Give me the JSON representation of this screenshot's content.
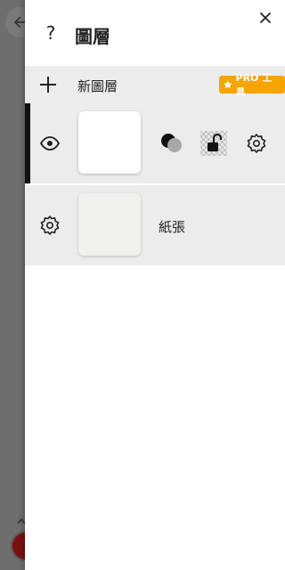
{
  "header": {
    "help_symbol": "?",
    "title": "圖層"
  },
  "new_layer": {
    "label": "新圖層",
    "pro_badge": "PRO 工具",
    "badge_color": "#f5a400"
  },
  "layers": [
    {
      "icons": [
        "eye-icon",
        "blend-mode-icon",
        "lock-icon",
        "gear-icon"
      ],
      "active": true
    }
  ],
  "paper": {
    "label": "紙張"
  }
}
